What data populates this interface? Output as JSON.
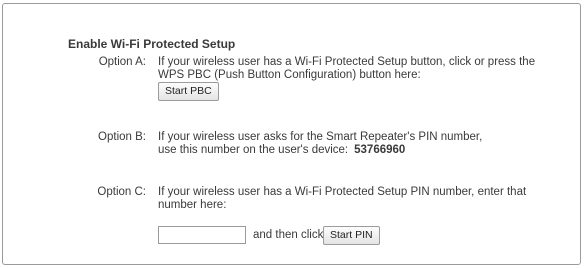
{
  "section": {
    "title": "Enable Wi-Fi Protected Setup"
  },
  "option_a": {
    "label": "Option A:",
    "line1": "If your wireless user has a Wi-Fi Protected Setup button, click or press the",
    "line2": "WPS PBC (Push Button Configuration) button here:",
    "button_label": "Start PBC"
  },
  "option_b": {
    "label": "Option B:",
    "line1": "If your wireless user asks for the Smart Repeater's PIN number,",
    "line2_prefix": "use this number on the user's device:",
    "pin": "53766960"
  },
  "option_c": {
    "label": "Option C:",
    "line1": "If your wireless user has a Wi-Fi Protected Setup PIN number, enter that",
    "line2": "number here:",
    "pin_input_value": "",
    "then_text": "and then click",
    "button_label": "Start PIN"
  }
}
